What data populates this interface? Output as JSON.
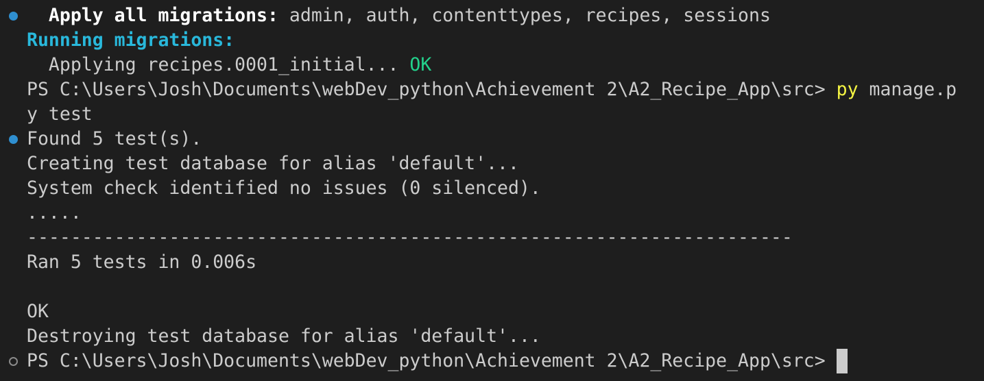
{
  "terminal": {
    "line1": {
      "indent": "  ",
      "bold": "Apply all migrations:",
      "rest": " admin, auth, contenttypes, recipes, sessions"
    },
    "line2": {
      "text": "Running migrations:"
    },
    "line3": {
      "text": "  Applying recipes.0001_initial... ",
      "ok": "OK"
    },
    "line4": {
      "prompt": "PS C:\\Users\\Josh\\Documents\\webDev_python\\Achievement 2\\A2_Recipe_App\\src> ",
      "command": "py",
      "args": " manage.p"
    },
    "line5": {
      "text": "y test"
    },
    "line6": {
      "text": "Found 5 test(s)."
    },
    "line7": {
      "text": "Creating test database for alias 'default'..."
    },
    "line8": {
      "text": "System check identified no issues (0 silenced)."
    },
    "line9": {
      "text": "....."
    },
    "line10": {
      "text": "----------------------------------------------------------------------"
    },
    "line11": {
      "text": "Ran 5 tests in 0.006s"
    },
    "line12": {
      "text": ""
    },
    "line13": {
      "text": "OK"
    },
    "line14": {
      "text": "Destroying test database for alias 'default'..."
    },
    "line15": {
      "prompt": "PS C:\\Users\\Josh\\Documents\\webDev_python\\Achievement 2\\A2_Recipe_App\\src> "
    }
  },
  "colors": {
    "background": "#1e1e1e",
    "text": "#cccccc",
    "heading": "#29b8db",
    "success": "#23d18b",
    "command": "#f5f543",
    "decoration_success": "#2f8fd0",
    "decoration_pending": "#8a8a8a"
  },
  "icons": {
    "decoration_1": "command-decoration-success-icon",
    "decoration_2": "command-decoration-success-icon",
    "decoration_3": "command-decoration-pending-icon"
  }
}
